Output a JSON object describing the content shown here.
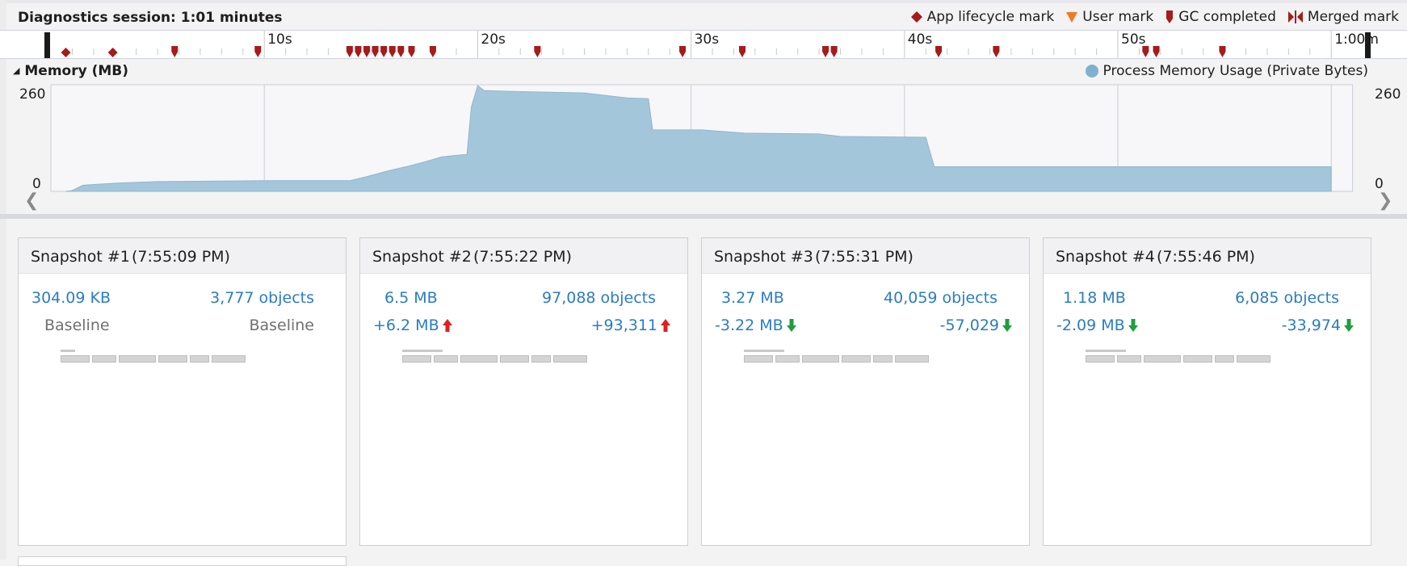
{
  "session": {
    "title": "Diagnostics session: 1:01 minutes"
  },
  "legend": {
    "items": [
      {
        "label": "App lifecycle mark",
        "icon": "diamond-icon",
        "color": "#a61b1b"
      },
      {
        "label": "User mark",
        "icon": "triangle-down-icon",
        "color": "#ef7a27"
      },
      {
        "label": "GC completed",
        "icon": "gc-marker-icon",
        "color": "#a61b1b"
      },
      {
        "label": "Merged mark",
        "icon": "merged-mark-icon",
        "color": "#a61b1b"
      }
    ]
  },
  "ruler": {
    "tick_labels": [
      "10s",
      "20s",
      "30s",
      "40s",
      "50s",
      "1:00m"
    ],
    "tick_seconds": [
      10,
      20,
      30,
      40,
      50,
      60
    ],
    "range_seconds": [
      0,
      61
    ],
    "app_lifecycle_marks_seconds": [
      0.7,
      2.9
    ],
    "gc_marks_seconds": [
      5.8,
      9.7,
      14.0,
      14.4,
      14.8,
      15.2,
      15.6,
      16.0,
      16.4,
      16.9,
      17.9,
      22.8,
      29.6,
      32.4,
      36.3,
      36.7,
      41.6,
      44.3,
      51.3,
      51.8,
      54.9
    ]
  },
  "memory": {
    "title": "Memory (MB)",
    "legend_label": "Process Memory Usage (Private Bytes)",
    "series_color": "#a4c6db",
    "y_max_label": "260",
    "y_min_label": "0"
  },
  "chart_data": {
    "type": "area",
    "xlabel": "",
    "ylabel": "",
    "xlim": [
      0,
      61
    ],
    "ylim": [
      0,
      260
    ],
    "series": [
      {
        "name": "Process Memory Usage (Private Bytes)",
        "points": [
          [
            0.7,
            0
          ],
          [
            1,
            2
          ],
          [
            1.5,
            15
          ],
          [
            3,
            20
          ],
          [
            5,
            24
          ],
          [
            10,
            26
          ],
          [
            14,
            26
          ],
          [
            14.8,
            36
          ],
          [
            15.8,
            50
          ],
          [
            16.8,
            62
          ],
          [
            17.8,
            76
          ],
          [
            18.3,
            84
          ],
          [
            19,
            88
          ],
          [
            19.5,
            90
          ],
          [
            19.7,
            205
          ],
          [
            20,
            258
          ],
          [
            20.3,
            246
          ],
          [
            21.5,
            244
          ],
          [
            25,
            240
          ],
          [
            27,
            228
          ],
          [
            28,
            226
          ],
          [
            28.2,
            150
          ],
          [
            30.5,
            150
          ],
          [
            32.5,
            142
          ],
          [
            36,
            140
          ],
          [
            37,
            134
          ],
          [
            41,
            132
          ],
          [
            41.4,
            60
          ],
          [
            50,
            60
          ],
          [
            60,
            60
          ]
        ]
      }
    ]
  },
  "snapshots": [
    {
      "name": "Snapshot #1",
      "time": "(7:55:09 PM)",
      "size": "304.09 KB",
      "objects": "3,777 objects",
      "baseline_left": "Baseline",
      "baseline_right": "Baseline",
      "is_baseline": true
    },
    {
      "name": "Snapshot #2",
      "time": "(7:55:22 PM)",
      "size": "6.5 MB",
      "objects": "97,088 objects",
      "delta_size": "+6.2 MB",
      "delta_objects": "+93,311",
      "trend": "up"
    },
    {
      "name": "Snapshot #3",
      "time": "(7:55:31 PM)",
      "size": "3.27 MB",
      "objects": "40,059 objects",
      "delta_size": "-3.22 MB",
      "delta_objects": "-57,029",
      "trend": "down"
    },
    {
      "name": "Snapshot #4",
      "time": "(7:55:46 PM)",
      "size": "1.18 MB",
      "objects": "6,085 objects",
      "delta_size": "-2.09 MB",
      "delta_objects": "-33,974",
      "trend": "down"
    }
  ],
  "colors": {
    "up_arrow": "#e01f1f",
    "down_arrow": "#1e9e3e",
    "link": "#2b7cc4"
  }
}
